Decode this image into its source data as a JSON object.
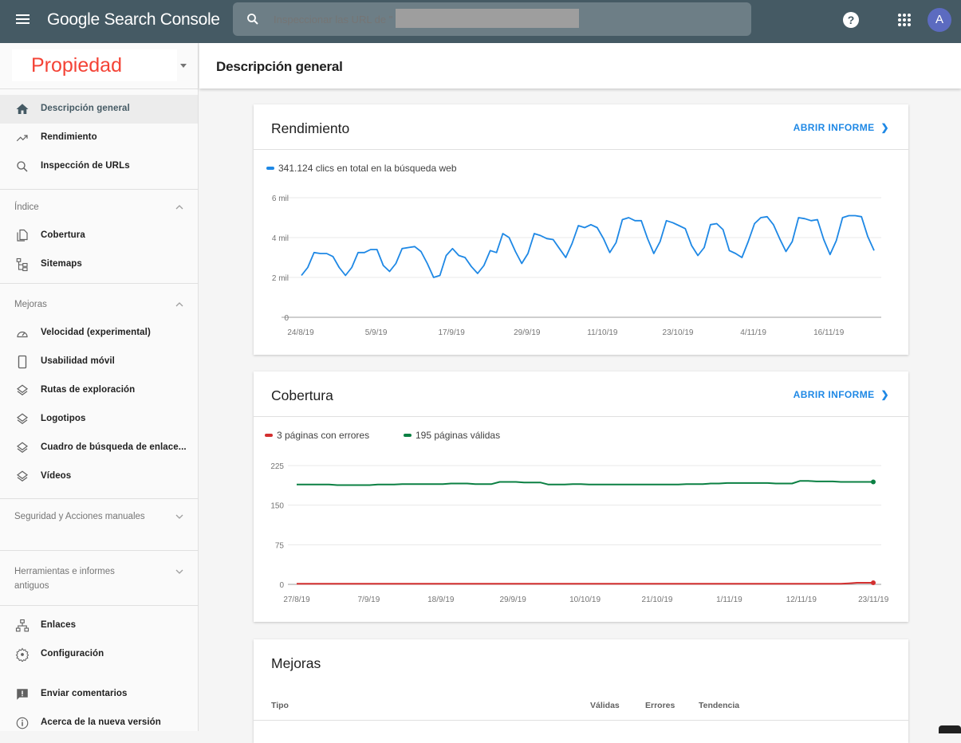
{
  "app": {
    "title": "Google Search Console",
    "logo_google": "Google",
    "logo_product": "Search Console"
  },
  "topbar": {
    "search_placeholder": "Inspeccionar las URL de \"",
    "help_icon": "help-icon",
    "apps_icon": "apps-grid-icon",
    "avatar_letter": "A"
  },
  "sidebar": {
    "property_label": "Propiedad",
    "top_items": [
      {
        "label": "Descripción general",
        "icon": "home-icon",
        "active": true
      },
      {
        "label": "Rendimiento",
        "icon": "trending-up-icon"
      },
      {
        "label": "Inspección de URLs",
        "icon": "search-icon"
      }
    ],
    "sections": [
      {
        "label": "Índice",
        "expanded": true,
        "items": [
          {
            "label": "Cobertura",
            "icon": "copy-pages-icon"
          },
          {
            "label": "Sitemaps",
            "icon": "sitemap-icon"
          }
        ]
      },
      {
        "label": "Mejoras",
        "expanded": true,
        "items": [
          {
            "label": "Velocidad (experimental)",
            "icon": "speedometer-icon"
          },
          {
            "label": "Usabilidad móvil",
            "icon": "phone-icon"
          },
          {
            "label": "Rutas de exploración",
            "icon": "layers-icon"
          },
          {
            "label": "Logotipos",
            "icon": "layers-icon"
          },
          {
            "label": "Cuadro de búsqueda de enlace...",
            "icon": "layers-icon"
          },
          {
            "label": "Vídeos",
            "icon": "layers-icon"
          }
        ]
      },
      {
        "label": "Seguridad y Acciones manuales",
        "expanded": false
      },
      {
        "label": "Herramientas e informes antiguos",
        "expanded": false
      }
    ],
    "bottom_items": [
      {
        "label": "Enlaces",
        "icon": "links-network-icon"
      },
      {
        "label": "Configuración",
        "icon": "gear-icon"
      },
      {
        "label": "Enviar comentarios",
        "icon": "feedback-icon"
      },
      {
        "label": "Acerca de la nueva versión",
        "icon": "info-icon"
      }
    ]
  },
  "header": {
    "title": "Descripción general"
  },
  "cards": {
    "performance": {
      "title": "Rendimiento",
      "open_label": "ABRIR INFORME",
      "legend": "341.124 clics en total en la búsqueda web",
      "color": "#1e88e5"
    },
    "coverage": {
      "title": "Cobertura",
      "open_label": "ABRIR INFORME",
      "legend_errors": "3 páginas con errores",
      "legend_valid": "195 páginas válidas",
      "color_errors": "#d32f2f",
      "color_valid": "#0b8043"
    },
    "enhancements": {
      "title": "Mejoras",
      "columns": [
        "Tipo",
        "Válidas",
        "Errores",
        "Tendencia"
      ]
    }
  },
  "chart_data": [
    {
      "type": "line",
      "title": "Rendimiento",
      "legend": [
        "341.124 clics en total en la búsqueda web"
      ],
      "xlabel": "",
      "ylabel": "",
      "ylim": [
        0,
        6000
      ],
      "yticks": [
        0,
        2000,
        4000,
        6000
      ],
      "ytick_labels": [
        "0",
        "2 mil",
        "4 mil",
        "6 mil"
      ],
      "xtick_labels": [
        "24/8/19",
        "5/9/19",
        "17/9/19",
        "29/9/19",
        "11/10/19",
        "23/10/19",
        "4/11/19",
        "16/11/19"
      ],
      "grid": true,
      "series": [
        {
          "name": "Clics",
          "color": "#1e88e5",
          "values": [
            2100,
            2500,
            3250,
            3200,
            3200,
            3050,
            2500,
            2100,
            2500,
            3250,
            3250,
            3400,
            3400,
            2600,
            2300,
            2700,
            3450,
            3500,
            3550,
            3300,
            2700,
            2000,
            2100,
            3100,
            3450,
            3100,
            3000,
            2550,
            2200,
            2600,
            3350,
            3250,
            4200,
            4000,
            3300,
            2700,
            3200,
            4200,
            4100,
            3950,
            3900,
            3450,
            3000,
            3700,
            4600,
            4500,
            4650,
            4500,
            3950,
            3250,
            3750,
            4900,
            5000,
            4850,
            4850,
            3950,
            3200,
            3800,
            4850,
            4750,
            4600,
            4450,
            3600,
            3100,
            3500,
            4650,
            4700,
            4400,
            3350,
            3200,
            3000,
            3800,
            4700,
            5000,
            5050,
            4650,
            3950,
            3300,
            3800,
            5000,
            4950,
            4850,
            4900,
            3900,
            3150,
            3850,
            5000,
            5100,
            5100,
            5050,
            4050,
            3350
          ]
        }
      ]
    },
    {
      "type": "line",
      "title": "Cobertura",
      "legend": [
        "3 páginas con errores",
        "195 páginas válidas"
      ],
      "xlabel": "",
      "ylabel": "",
      "ylim": [
        0,
        225
      ],
      "yticks": [
        0,
        75,
        150,
        225
      ],
      "ytick_labels": [
        "0",
        "75",
        "150",
        "225"
      ],
      "xtick_labels": [
        "27/8/19",
        "7/9/19",
        "18/9/19",
        "29/9/19",
        "10/10/19",
        "21/10/19",
        "1/11/19",
        "12/11/19",
        "23/11/19"
      ],
      "grid": true,
      "series": [
        {
          "name": "Páginas válidas",
          "color": "#0b8043",
          "values": [
            189,
            189,
            189,
            189,
            189,
            188,
            188,
            188,
            188,
            188,
            189,
            189,
            189,
            190,
            190,
            190,
            190,
            190,
            190,
            191,
            191,
            191,
            190,
            190,
            190,
            194,
            194,
            194,
            193,
            193,
            193,
            189,
            189,
            189,
            190,
            190,
            189,
            189,
            189,
            189,
            189,
            189,
            189,
            189,
            189,
            189,
            189,
            189,
            190,
            190,
            190,
            191,
            191,
            192,
            192,
            192,
            192,
            192,
            192,
            191,
            191,
            191,
            196,
            196,
            195,
            195,
            195,
            194,
            194,
            194,
            194,
            194
          ]
        },
        {
          "name": "Páginas con errores",
          "color": "#d32f2f",
          "values": [
            1,
            1,
            1,
            1,
            1,
            1,
            1,
            1,
            1,
            1,
            1,
            1,
            1,
            1,
            1,
            1,
            1,
            1,
            1,
            1,
            1,
            1,
            1,
            1,
            1,
            1,
            1,
            1,
            1,
            1,
            1,
            1,
            1,
            1,
            1,
            1,
            1,
            1,
            1,
            1,
            1,
            1,
            1,
            1,
            1,
            1,
            1,
            1,
            1,
            1,
            1,
            1,
            1,
            1,
            1,
            1,
            1,
            1,
            1,
            1,
            1,
            1,
            1,
            1,
            1,
            1,
            1,
            1,
            2,
            3,
            3,
            3
          ]
        }
      ]
    }
  ]
}
